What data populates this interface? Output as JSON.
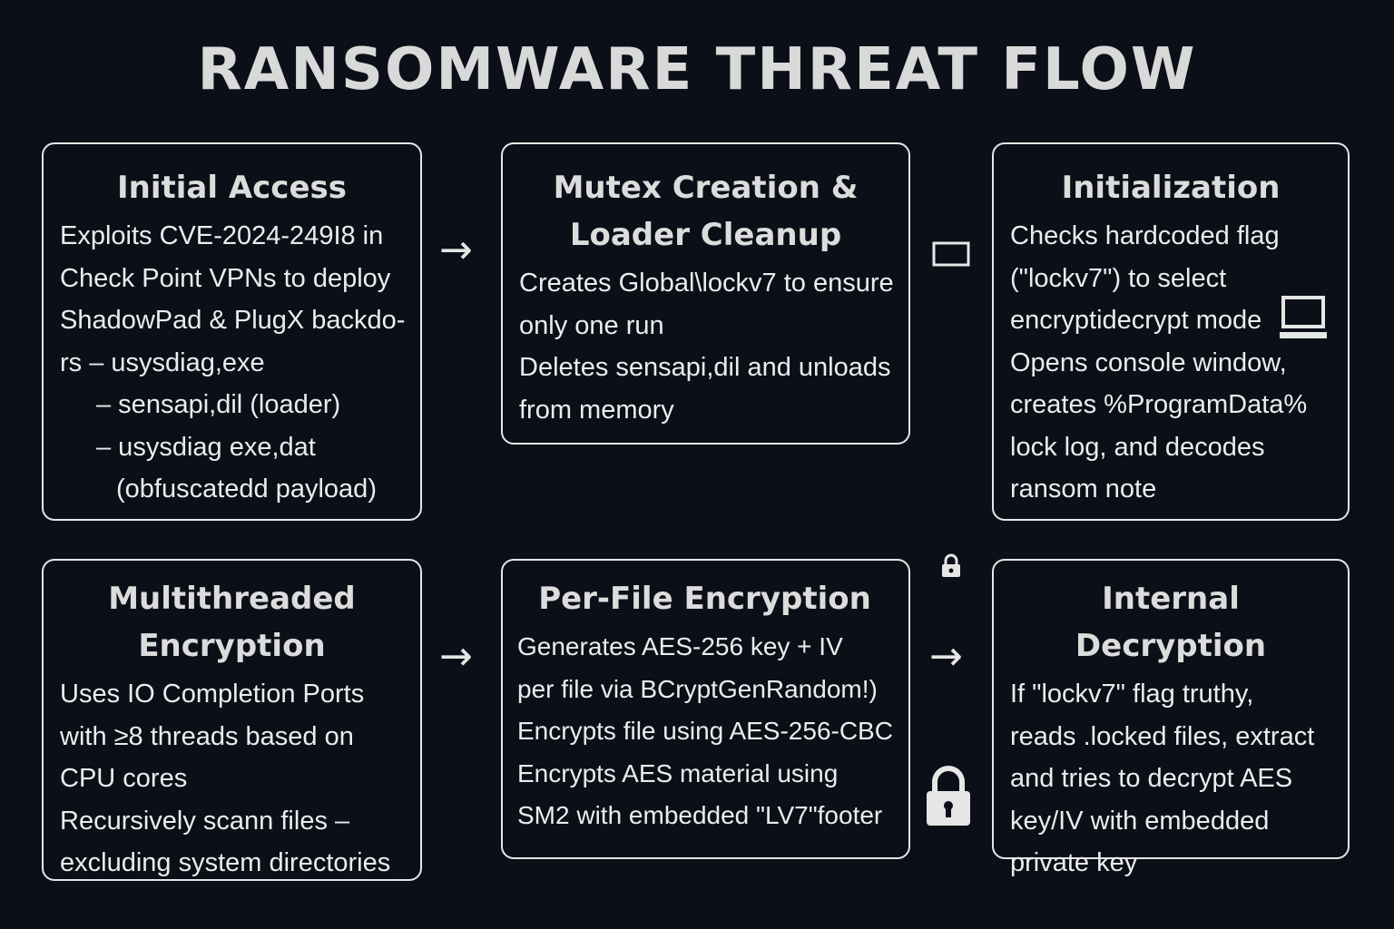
{
  "title": "RANSOMWARE THREAT FLOW",
  "boxes": [
    {
      "heading": "Initial Access",
      "lines": [
        "Exploits CVE-2024-249I8 in",
        "Check Point VPNs to deploy",
        "ShadowPad & PlugX backdo-",
        "rs  – usysdiag,exe",
        "– sensapi,dil (loader)",
        "– usysdiag exe,dat",
        "(obfuscatedd payload)"
      ]
    },
    {
      "heading": "Mutex Creation &",
      "heading2": "Loader Cleanup",
      "lines": [
        "Creates Global\\lockv7 to ensure",
        "only one run",
        "Deletes sensapi,dil and unloads",
        "from memory"
      ]
    },
    {
      "heading": "Initialization",
      "lines": [
        "Checks hardcoded flag",
        "(\"lockv7\") to select",
        "encryptidecrypt mode",
        "Opens console window,",
        "creates %ProgramData%",
        "lock log, and decodes",
        "ransom note"
      ]
    },
    {
      "heading": "Multithreaded",
      "heading2": "Encryption",
      "lines": [
        "Uses IO Completion Ports",
        "with ≥8 threads based on",
        "CPU cores",
        "Recursively scann files –",
        "excluding system directories"
      ]
    },
    {
      "heading": "Per-File Encryption",
      "lines": [
        "Generates AES-256 key + IV",
        "per file via BCryptGenRandom!)",
        "Encrypts file using AES-256-CBC",
        "Encrypts AES material using",
        "SM2 with embedded \"LV7\"footer"
      ]
    },
    {
      "heading": "Internal Decryption",
      "lines": [
        "If \"lockv7\" flag truthy,",
        "reads .locked files, extract",
        "and tries to decrypt AES",
        "key/IV with embedded",
        "private key"
      ]
    }
  ],
  "arrows": [
    "→",
    "→",
    "→"
  ],
  "icons": [
    "window-icon",
    "laptop-icon",
    "small-lock-icon",
    "padlock-icon"
  ]
}
